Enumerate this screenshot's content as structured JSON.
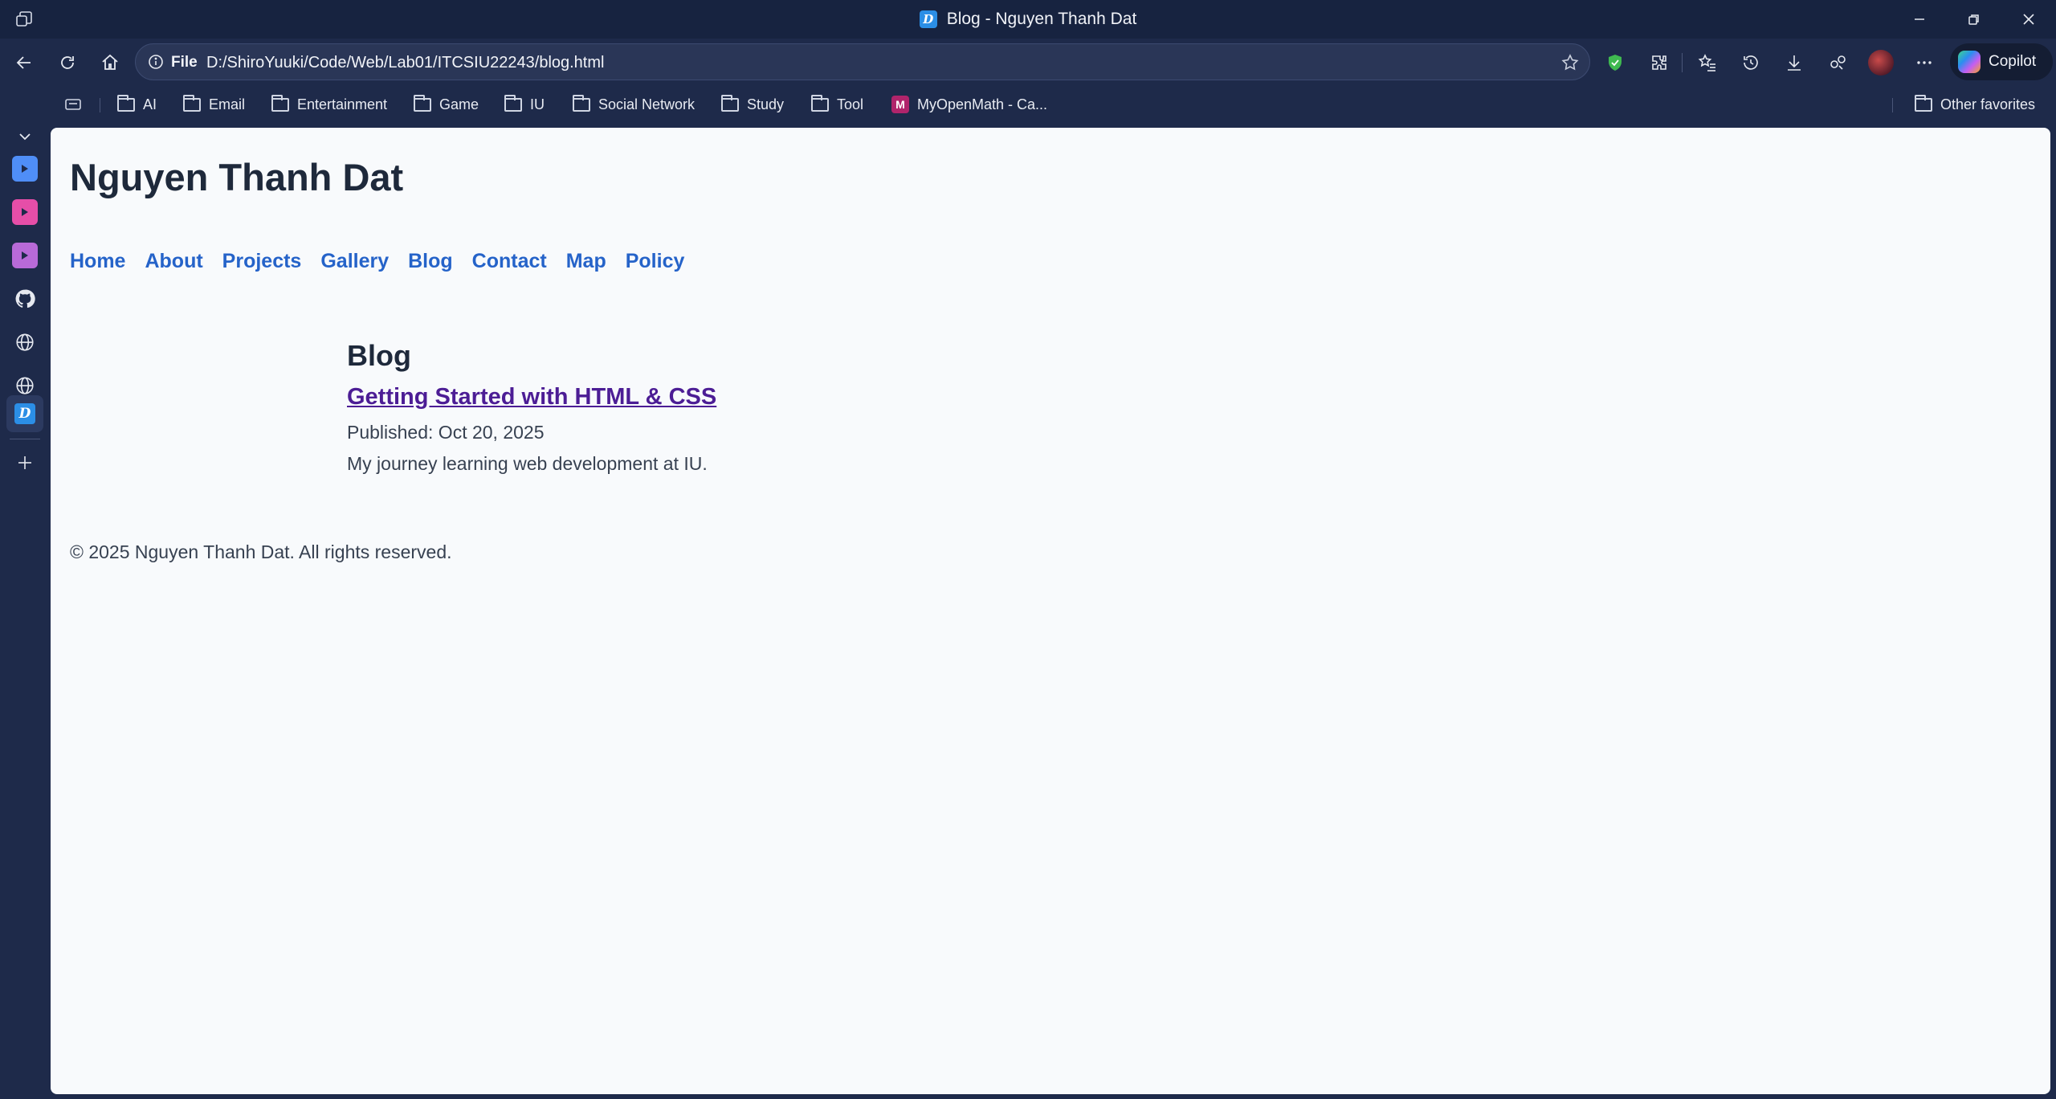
{
  "window": {
    "title": "Blog - Nguyen Thanh Dat",
    "favicon_letter": "D"
  },
  "address_bar": {
    "scheme_label": "File",
    "url": "D:/ShiroYuuki/Code/Web/Lab01/ITCSIU22243/blog.html"
  },
  "copilot": {
    "label": "Copilot"
  },
  "favorites": {
    "items": [
      {
        "label": "AI",
        "icon": "folder-icon"
      },
      {
        "label": "Email",
        "icon": "folder-icon"
      },
      {
        "label": "Entertainment",
        "icon": "folder-icon"
      },
      {
        "label": "Game",
        "icon": "folder-icon"
      },
      {
        "label": "IU",
        "icon": "folder-icon"
      },
      {
        "label": "Social Network",
        "icon": "folder-icon"
      },
      {
        "label": "Study",
        "icon": "folder-icon"
      },
      {
        "label": "Tool",
        "icon": "folder-icon"
      },
      {
        "label": "MyOpenMath - Ca...",
        "icon": "myopenmath-icon"
      }
    ],
    "other": "Other favorites"
  },
  "page": {
    "site_title": "Nguyen Thanh Dat",
    "nav": [
      "Home",
      "About",
      "Projects",
      "Gallery",
      "Blog",
      "Contact",
      "Map",
      "Policy"
    ],
    "section_heading": "Blog",
    "post": {
      "title": "Getting Started with HTML & CSS",
      "published": "Published: Oct 20, 2025",
      "description": "My journey learning web development at IU."
    },
    "footer": "© 2025 Nguyen Thanh Dat. All rights reserved."
  },
  "colors": {
    "chrome_bg": "#1e2a4a",
    "page_bg": "#f8fafc",
    "nav_link": "#2563c9",
    "visited_link": "#4c1d95"
  }
}
